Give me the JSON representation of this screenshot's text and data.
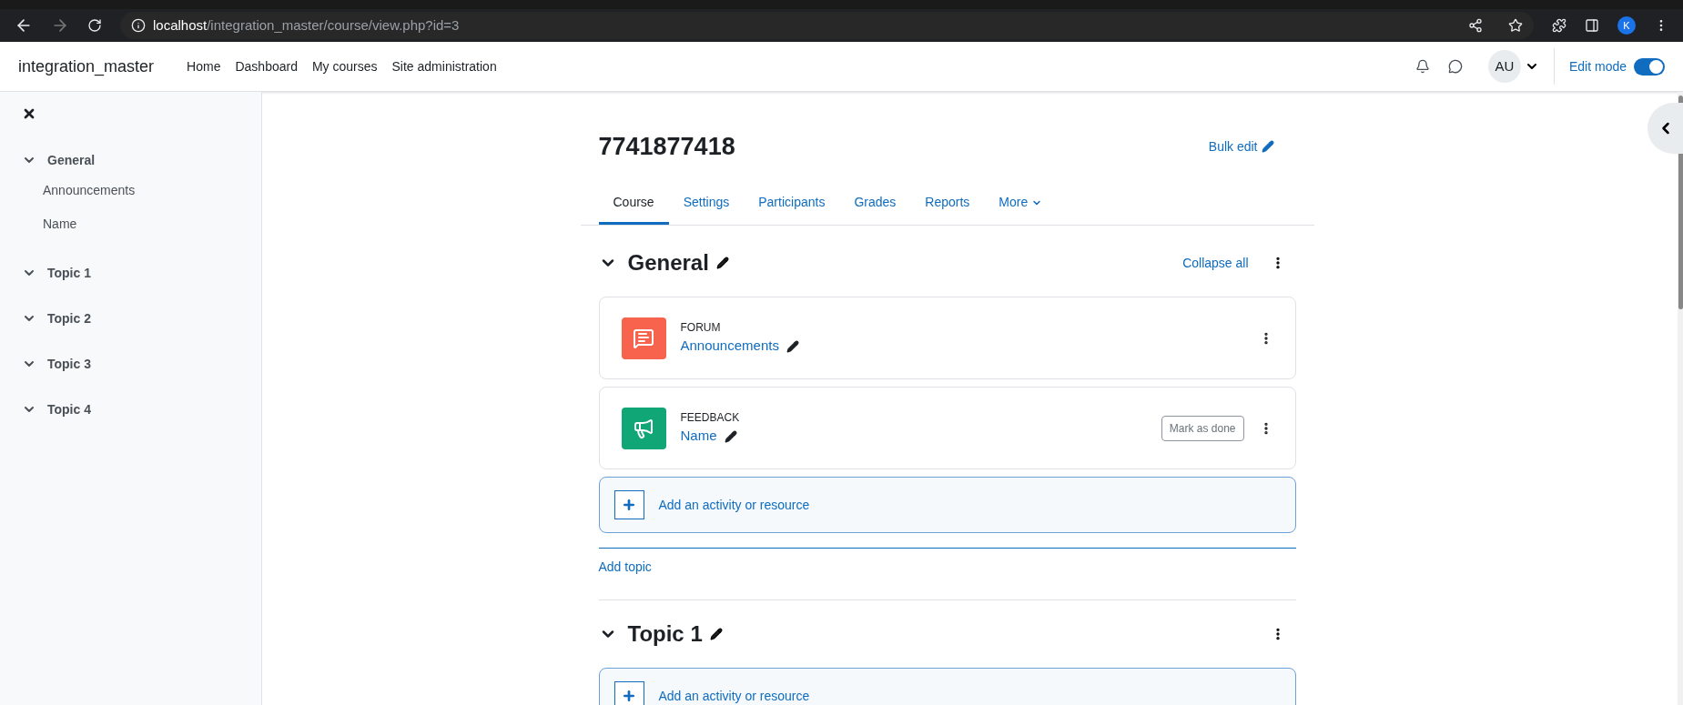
{
  "browser": {
    "url_host": "localhost",
    "url_path": "/integration_master/course/view.php?id=3",
    "profile_initial": "K"
  },
  "navbar": {
    "site_name": "integration_master",
    "links": [
      "Home",
      "Dashboard",
      "My courses",
      "Site administration"
    ],
    "avatar": "AU",
    "edit_mode": {
      "label": "Edit mode",
      "on": true
    }
  },
  "sidebar": {
    "items": [
      {
        "label": "General",
        "expanded": true,
        "children": [
          {
            "label": "Announcements"
          },
          {
            "label": "Name"
          }
        ]
      },
      {
        "label": "Topic 1",
        "expanded": true
      },
      {
        "label": "Topic 2",
        "expanded": true
      },
      {
        "label": "Topic 3",
        "expanded": true
      },
      {
        "label": "Topic 4",
        "expanded": true
      }
    ]
  },
  "course": {
    "title": "7741877418",
    "bulk_edit": "Bulk edit",
    "tabs": [
      {
        "label": "Course",
        "selected": true
      },
      {
        "label": "Settings",
        "selected": false
      },
      {
        "label": "Participants",
        "selected": false
      },
      {
        "label": "Grades",
        "selected": false
      },
      {
        "label": "Reports",
        "selected": false
      },
      {
        "label": "More",
        "selected": false
      }
    ],
    "collapse_all": "Collapse all",
    "sections": [
      {
        "title": "General",
        "expanded": true,
        "activities": [
          {
            "kind": "forum",
            "type": "FORUM",
            "name": "Announcements",
            "color": "#f7634d"
          },
          {
            "kind": "feedback",
            "type": "FEEDBACK",
            "name": "Name",
            "color": "#11a676",
            "completion": "Mark as done"
          }
        ],
        "add_activity": "Add an activity or resource",
        "add_topic": "Add topic"
      },
      {
        "title": "Topic 1",
        "expanded": true,
        "add_activity": "Add an activity or resource"
      }
    ]
  }
}
